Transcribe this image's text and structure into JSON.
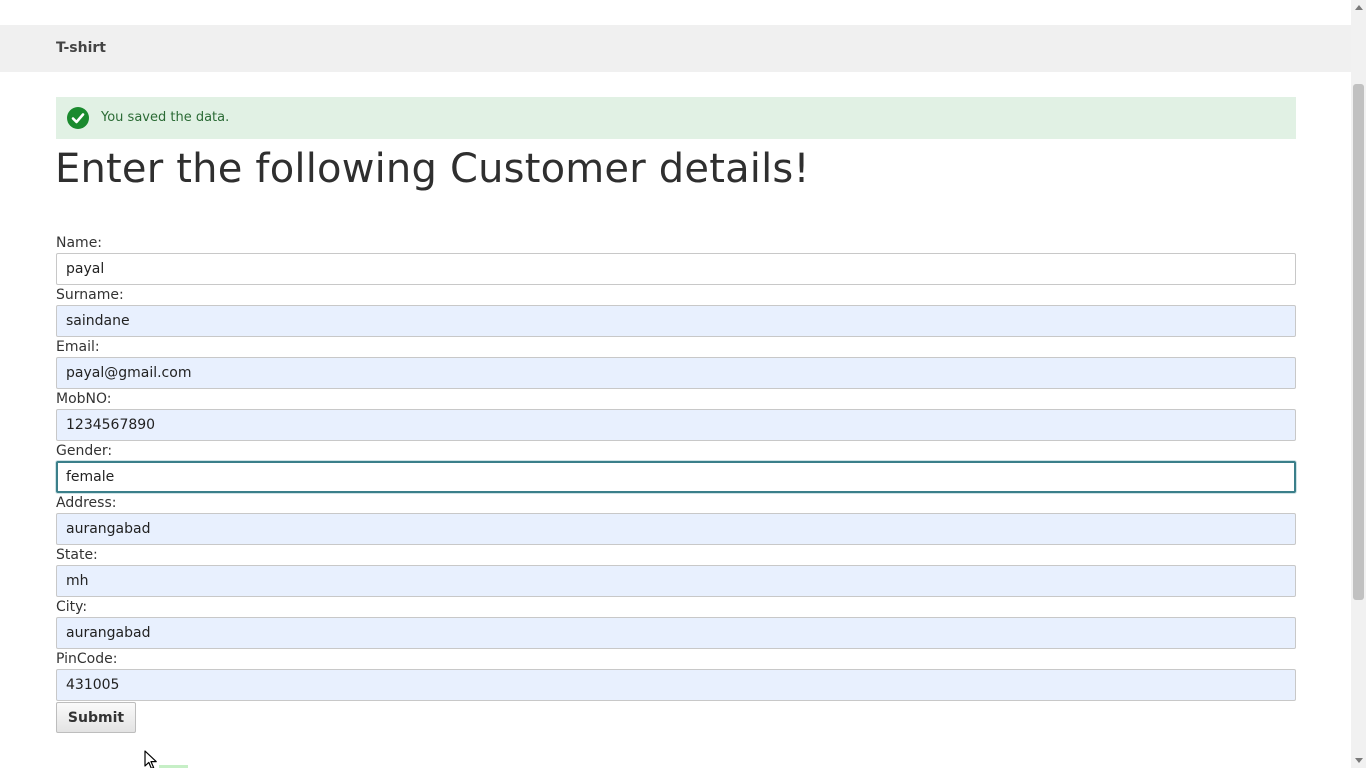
{
  "breadcrumb": {
    "label": "T-shirt"
  },
  "status": {
    "message": "You saved the data.",
    "color": "#1a8a2e"
  },
  "page": {
    "title": "Enter the following Customer details!"
  },
  "form": {
    "fields": [
      {
        "label": "Name:",
        "value": "payal"
      },
      {
        "label": "Surname:",
        "value": "saindane"
      },
      {
        "label": "Email:",
        "value": "payal@gmail.com"
      },
      {
        "label": "MobNO:",
        "value": "1234567890"
      },
      {
        "label": "Gender:",
        "value": "female"
      },
      {
        "label": "Address:",
        "value": "aurangabad"
      },
      {
        "label": "State:",
        "value": "mh"
      },
      {
        "label": "City:",
        "value": "aurangabad"
      },
      {
        "label": "PinCode:",
        "value": "431005"
      }
    ],
    "submit_label": "Submit",
    "focused_field": "Gender:"
  },
  "icons": {
    "status": "check-circle-icon",
    "cursor": "mouse-pointer-icon"
  }
}
